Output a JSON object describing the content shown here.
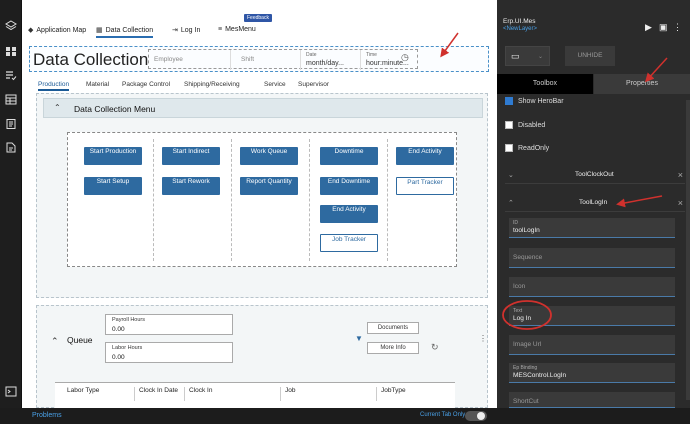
{
  "colors": {
    "accent": "#2e6aa0",
    "annotation": "#d0312d",
    "link": "#4aa0e6"
  },
  "rail_icons": [
    "layers-icon",
    "grid-icon",
    "list-check-icon",
    "table-icon",
    "clipboard-icon",
    "document-icon",
    "terminal-icon"
  ],
  "nav": {
    "items": [
      {
        "label": "Application Map",
        "icon": "map-pin-icon"
      },
      {
        "label": "Data Collection",
        "icon": "data-icon"
      },
      {
        "label": "Log In",
        "icon": "login-icon"
      },
      {
        "label": "MesMenu",
        "icon": "menu-icon"
      }
    ],
    "feedback": "Feedback"
  },
  "herobar": {
    "title": "Data Collection",
    "employee_placeholder": "Employee",
    "shift_placeholder": "Shift",
    "date_label": "Date",
    "date_value": "month/day...",
    "time_label": "Time",
    "time_value": "hour:minute..."
  },
  "tabs": [
    "Production",
    "Material",
    "Package Control",
    "Shipping/Receiving",
    "Service",
    "Supervisor"
  ],
  "menu": {
    "title": "Data Collection Menu",
    "columns": [
      [
        {
          "label": "Start Production"
        },
        {
          "label": "Start Setup"
        }
      ],
      [
        {
          "label": "Start Indirect"
        },
        {
          "label": "Start Rework"
        }
      ],
      [
        {
          "label": "Work Queue"
        },
        {
          "label": "Report Quantity"
        }
      ],
      [
        {
          "label": "Downtime"
        },
        {
          "label": "End Downtime"
        },
        {
          "label": "End Activity"
        },
        {
          "label": "Job Tracker",
          "outline": true
        }
      ],
      [
        {
          "label": "End Activity"
        },
        {
          "label": "Part Tracker",
          "outline": true
        }
      ]
    ]
  },
  "queue": {
    "title": "Queue",
    "payroll_label": "Payroll Hours",
    "payroll_value": "0.00",
    "labor_label": "Labor Hours",
    "labor_value": "0.00",
    "documents": "Documents",
    "more_info": "More Info",
    "table_headers": [
      "Labor Type",
      "Clock In Date",
      "Clock In",
      "Job",
      "JobType"
    ]
  },
  "status": {
    "problems": "Problems",
    "current_tab_only": "Current Tab Only"
  },
  "props": {
    "app": "Erp.UI.Mes",
    "layer": "<NewLayer>",
    "unhide": "UNHIDE",
    "toolbox_tab": "Toolbox",
    "properties_tab": "Properties",
    "checks": [
      {
        "label": "Show HeroBar",
        "checked": true
      },
      {
        "label": "Disabled",
        "checked": false
      },
      {
        "label": "ReadOnly",
        "checked": false
      }
    ],
    "group1": "ToolClockOut",
    "group2": "ToolLogIn",
    "fields": [
      {
        "label": "ID",
        "value": "toolLogIn"
      },
      {
        "label": "",
        "value": "",
        "placeholder": "Sequence"
      },
      {
        "label": "",
        "value": "",
        "placeholder": "Icon"
      },
      {
        "label": "Text",
        "value": "Log In"
      },
      {
        "label": "",
        "value": "",
        "placeholder": "Image Url"
      },
      {
        "label": "Ep Binding",
        "value": "MESControl.LogIn"
      },
      {
        "label": "",
        "value": "",
        "placeholder": "ShortCut"
      }
    ]
  }
}
